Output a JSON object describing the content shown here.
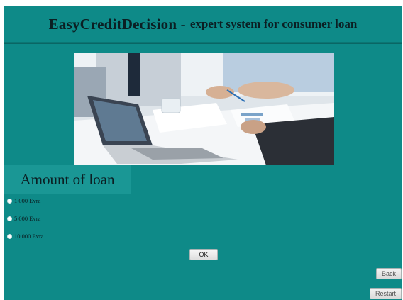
{
  "header": {
    "title_main": "EasyCreditDecision -",
    "title_sub": "expert system for consumer loan"
  },
  "section": {
    "title": "Amount of loan"
  },
  "options": [
    {
      "label": "1 000 Evra"
    },
    {
      "label": "5 000 Evra"
    },
    {
      "label": "10 000 Evra"
    }
  ],
  "buttons": {
    "ok": "OK",
    "back": "Back",
    "restart": "Restart"
  },
  "colors": {
    "background": "#0e8a88",
    "section_title_bg": "#1a9795",
    "text": "#0b1f23"
  },
  "images": {
    "banner": "business-meeting-photo"
  }
}
